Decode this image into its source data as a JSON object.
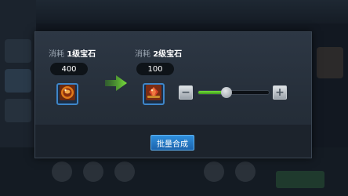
{
  "merge_dialog": {
    "source": {
      "cost_prefix": "消耗",
      "cost_item": "1级宝石",
      "count": "400",
      "gem_icon": "level-1-gem-icon"
    },
    "target": {
      "cost_prefix": "消耗",
      "cost_item": "2级宝石",
      "count": "100",
      "gem_icon": "level-2-gem-icon"
    },
    "quantity_slider": {
      "decrease_symbol": "−",
      "increase_symbol": "+",
      "level": 0.4
    },
    "confirm_label": "批量合成"
  },
  "colors": {
    "accent_green": "#6fd836",
    "button_blue": "#2a84d2",
    "slot_border": "#3e86c9"
  }
}
